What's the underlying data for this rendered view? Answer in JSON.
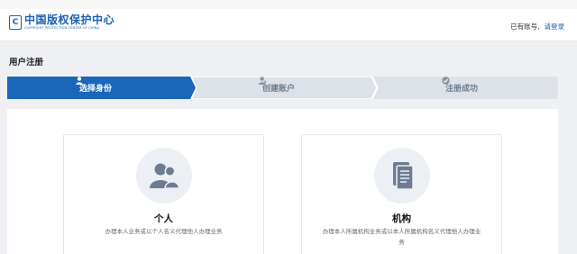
{
  "header": {
    "logo_mark": "C",
    "logo_cn": "中国版权保护中心",
    "logo_en": "COPYRIGHT PROTECTION CENTER OF CHINA",
    "has_account": "已有账号,",
    "login_link": "请登录"
  },
  "page_title": "用户注册",
  "steps": [
    {
      "label": "选择身份",
      "icon": "user-icon",
      "state": "active"
    },
    {
      "label": "创建账户",
      "icon": "user-add-icon",
      "state": "inactive"
    },
    {
      "label": "注册成功",
      "icon": "check-circle-icon",
      "state": "inactive"
    }
  ],
  "cards": [
    {
      "title": "个人",
      "desc": "办理本人业务或以个人名义代理他人办理业务",
      "icon": "users-icon"
    },
    {
      "title": "机构",
      "desc": "办理本人所属机构业务或以本人所属机构名义代理他人办理业务",
      "icon": "document-icon"
    }
  ],
  "colors": {
    "accent": "#1d5fb3",
    "step_active": "#1a66b8",
    "step_inactive": "#dde1e8",
    "icon_gray": "#6d7c92",
    "background": "#eef0f4"
  }
}
